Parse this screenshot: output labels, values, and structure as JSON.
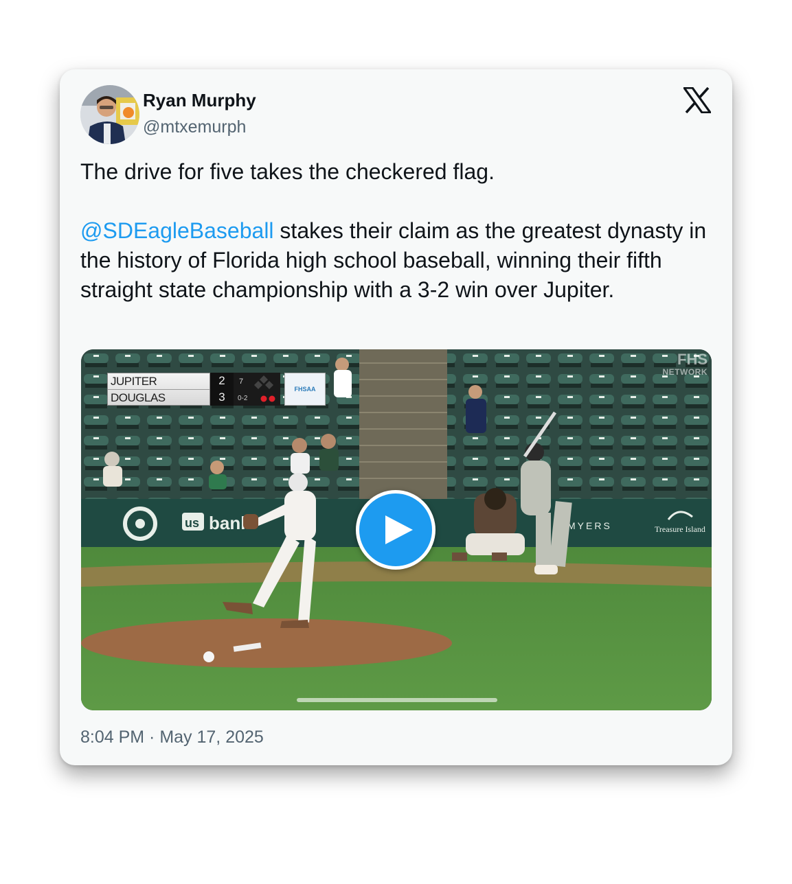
{
  "author": {
    "name": "Ryan Murphy",
    "handle": "@mtxemurph",
    "avatar_icon": "avatar-photo"
  },
  "platform_icon": "x-logo-icon",
  "tweet": {
    "line1": "The drive for five takes the checkered flag.",
    "mention": "@SDEagleBaseball",
    "body": " stakes their claim as the greatest dynasty in the history of Florida high school baseball, winning their fifth straight state championship with a 3-2 win over Jupiter."
  },
  "media": {
    "type": "video",
    "play_icon": "play-icon",
    "scorebug": {
      "team1": "JUPITER",
      "score1": "2",
      "team2": "DOUGLAS",
      "score2": "3",
      "count": "0-2",
      "inning": "7"
    },
    "network_logo": "FHS",
    "network_sub": "NETWORK",
    "signage": {
      "sign1": "us bank",
      "sign2": "MYERS",
      "sign3": "Treasure Island"
    }
  },
  "timestamp": "8:04 PM · May 17, 2025",
  "colors": {
    "accent": "#1d9bf0",
    "text": "#0f1419",
    "secondary": "#536471",
    "card_bg": "#f7f9f9"
  }
}
